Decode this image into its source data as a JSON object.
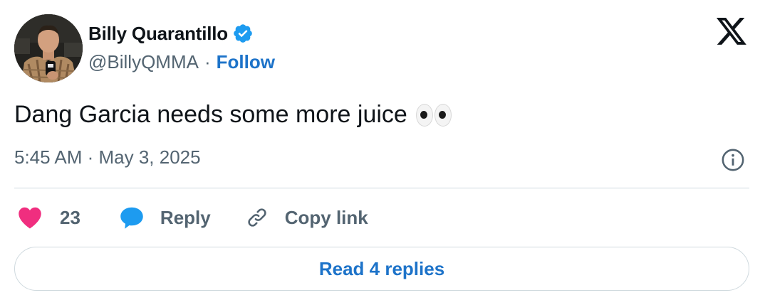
{
  "author": {
    "display_name": "Billy Quarantillo",
    "handle": "@BillyQMMA",
    "separator": "·",
    "follow_label": "Follow",
    "verified": true
  },
  "tweet": {
    "text": "Dang Garcia needs some more juice",
    "emoji": "eyes-emoji",
    "timestamp": "5:45 AM · May 3, 2025"
  },
  "actions": {
    "like_count": "23",
    "reply_label": "Reply",
    "copy_link_label": "Copy link"
  },
  "footer": {
    "read_replies_label": "Read 4 replies"
  },
  "colors": {
    "accent": "#1d73c9",
    "verified_badge": "#1d9bf0",
    "like": "#f02e7f",
    "reply_bubble": "#1d9bf0",
    "text_secondary": "#536471",
    "divider": "#cfd9de"
  },
  "icons": [
    "verified-badge-icon",
    "x-logo-icon",
    "info-icon",
    "heart-icon",
    "reply-bubble-icon",
    "link-icon"
  ]
}
